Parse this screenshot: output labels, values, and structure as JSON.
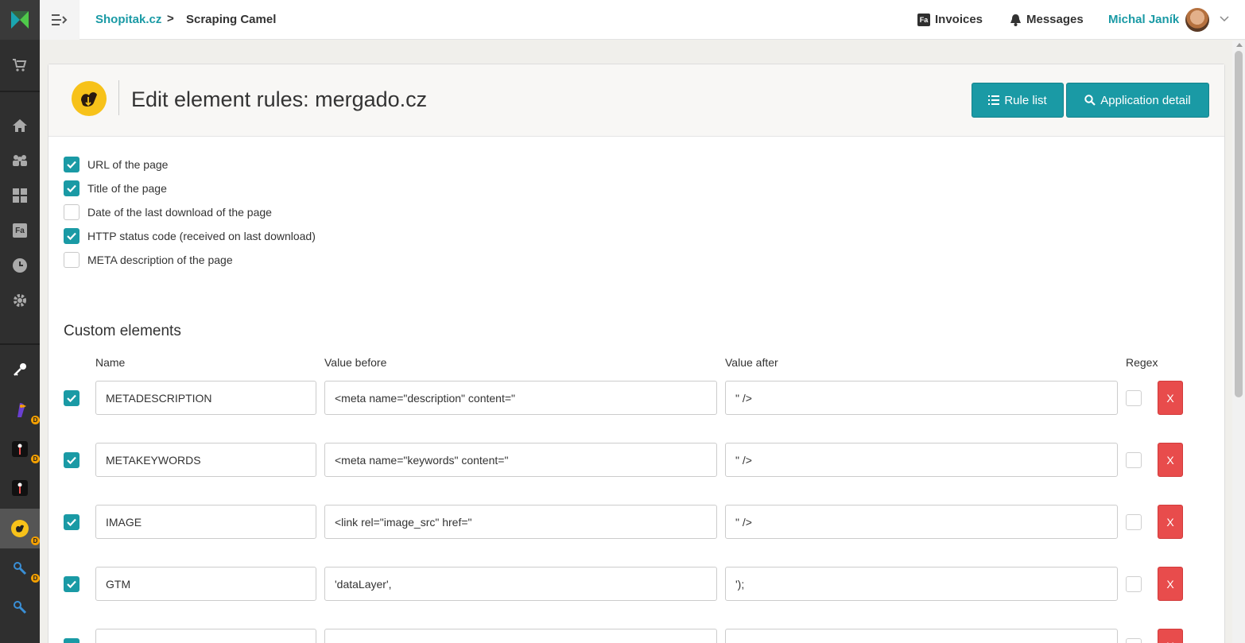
{
  "breadcrumb": {
    "parent": "Shopitak.cz",
    "separator": ">",
    "current": "Scraping Camel"
  },
  "topbar": {
    "invoices": "Invoices",
    "invoices_badge": "Fa",
    "messages": "Messages",
    "user": "Michal Janík"
  },
  "sidebar": {
    "invoice_badge": "Fa",
    "dev_badge": "D"
  },
  "page": {
    "title": "Edit element rules: mergado.cz"
  },
  "buttons": {
    "rule_list": "Rule list",
    "app_detail": "Application detail"
  },
  "options": [
    {
      "label": "URL of the page",
      "checked": true
    },
    {
      "label": "Title of the page",
      "checked": true
    },
    {
      "label": "Date of the last download of the page",
      "checked": false
    },
    {
      "label": "HTTP status code (received on last download)",
      "checked": true
    },
    {
      "label": "META description of the page",
      "checked": false
    }
  ],
  "custom": {
    "title": "Custom elements",
    "columns": {
      "name": "Name",
      "before": "Value before",
      "after": "Value after",
      "regex": "Regex"
    },
    "delete_label": "X",
    "rows": [
      {
        "enabled": true,
        "name": "METADESCRIPTION",
        "before": "<meta name=\"description\" content=\"",
        "after": "\" />",
        "regex": false
      },
      {
        "enabled": true,
        "name": "METAKEYWORDS",
        "before": "<meta name=\"keywords\" content=\"",
        "after": "\" />",
        "regex": false
      },
      {
        "enabled": true,
        "name": "IMAGE",
        "before": "<link rel=\"image_src\" href=\"",
        "after": "\" />",
        "regex": false
      },
      {
        "enabled": true,
        "name": "GTM",
        "before": "'dataLayer',",
        "after": "');",
        "regex": false
      },
      {
        "enabled": true,
        "name": "",
        "before": "",
        "after": "",
        "regex": false
      }
    ]
  },
  "colors": {
    "accent": "#1a9aa5",
    "danger": "#e84c4c",
    "sidebar": "#2f2f2f"
  }
}
